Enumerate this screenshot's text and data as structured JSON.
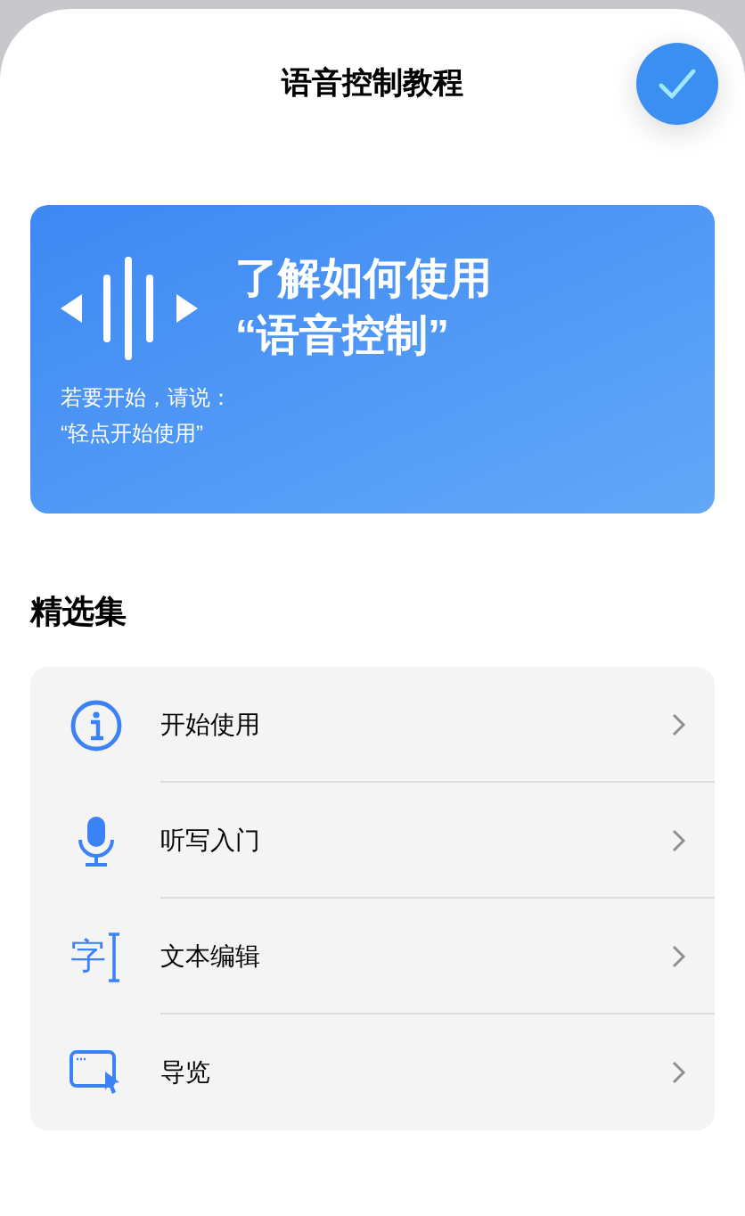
{
  "header": {
    "title": "语音控制教程"
  },
  "banner": {
    "headline": [
      "了解如何使用",
      "“语音控制”"
    ],
    "hint": [
      "若要开始，请说：",
      "“轻点开始使用”"
    ]
  },
  "section": {
    "title": "精选集"
  },
  "items": [
    {
      "kind": "info",
      "label": "开始使用"
    },
    {
      "kind": "mic",
      "label": "听写入门"
    },
    {
      "kind": "text",
      "glyph": "字",
      "label": "文本编辑"
    },
    {
      "kind": "window",
      "label": "导览"
    }
  ]
}
